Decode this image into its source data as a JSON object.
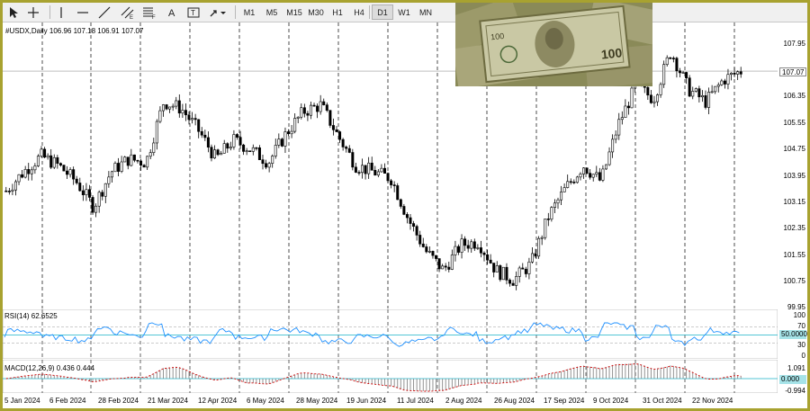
{
  "toolbar": {
    "timeframes": [
      "M1",
      "M5",
      "M15",
      "M30",
      "H1",
      "H4",
      "D1",
      "W1",
      "MN"
    ],
    "active_timeframe": "D1"
  },
  "chart": {
    "title": "#USDX,Daily  106.96 107.18 106.91 107.07",
    "current_price": "107.07",
    "price_labels": [
      "107.95",
      "106.35",
      "105.55",
      "104.75",
      "103.95",
      "103.15",
      "102.35",
      "101.55",
      "100.75",
      "99.95"
    ],
    "date_labels": [
      "5 Jan 2024",
      "6 Feb 2024",
      "28 Feb 2024",
      "21 Mar 2024",
      "12 Apr 2024",
      "6 May 2024",
      "28 May 2024",
      "19 Jun 2024",
      "11 Jul 2024",
      "2 Aug 2024",
      "26 Aug 2024",
      "17 Sep 2024",
      "9 Oct 2024",
      "31 Oct 2024",
      "22 Nov 2024"
    ]
  },
  "rsi": {
    "title": "RSI(14) 62.6525",
    "levels": [
      "100",
      "70",
      "30",
      "0"
    ],
    "current_tag": "50.0000"
  },
  "macd": {
    "title": "MACD(12,26,9) 0.436 0.444",
    "labels": [
      "1.091",
      "-0.994"
    ],
    "current_tag": "0.000"
  },
  "colors": {
    "frame": "#a8a230",
    "candle": "#000000",
    "rsi_line": "#1e90ff",
    "macd_signal": "#d00000",
    "current_price_bg": "#ffffff",
    "tag_bg": "#a6e3e8"
  },
  "chart_data": {
    "type": "candlestick",
    "symbol": "#USDX",
    "timeframe": "Daily",
    "ylim": [
      99.6,
      108.6
    ],
    "series": [
      {
        "name": "close",
        "values": [
          103.3,
          103.9,
          104.4,
          104.1,
          103.6,
          102.8,
          103.9,
          104.3,
          104.2,
          106.1,
          105.9,
          105.2,
          104.3,
          104.9,
          104.6,
          104.2,
          105.1,
          105.8,
          106.0,
          105.0,
          104.1,
          103.9,
          103.7,
          102.4,
          101.4,
          100.8,
          101.6,
          101.7,
          100.8,
          100.5,
          101.0,
          102.5,
          103.4,
          104.1,
          103.6,
          105.4,
          106.6,
          106.2,
          107.7,
          106.5,
          106.1,
          106.8,
          107.07
        ]
      }
    ]
  }
}
